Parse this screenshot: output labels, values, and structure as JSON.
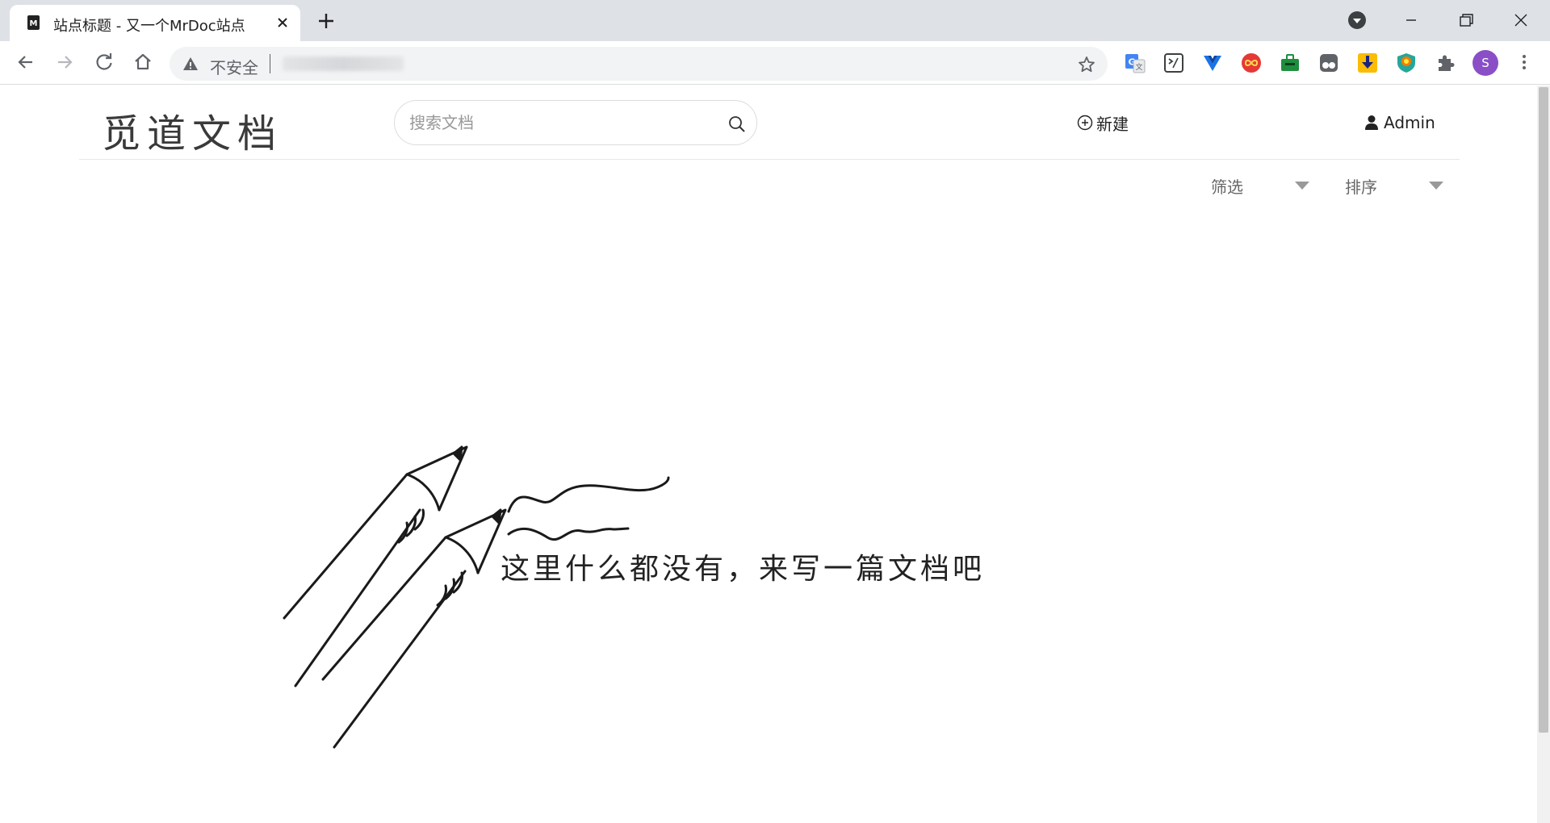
{
  "browser": {
    "tab_title": "站点标题 - 又一个MrDoc站点",
    "new_tab_icon": "plus-icon",
    "address_bar": {
      "security_label": "不安全",
      "security_icon": "warning-triangle-icon"
    },
    "profile_initial": "S",
    "extensions": [
      "google-translate-icon",
      "terminal-icon",
      "vue-devtools-icon",
      "infinity-icon",
      "toolbox-icon",
      "tampermonkey-icon",
      "download-icon",
      "shield-extension-icon",
      "puzzle-icon"
    ]
  },
  "header": {
    "logo_text": "觅道文档",
    "search_placeholder": "搜索文档",
    "new_label": "新建",
    "user_label": "Admin"
  },
  "filters": {
    "filter_label": "筛选",
    "sort_label": "排序"
  },
  "empty_state": {
    "message": "这里什么都没有，来写一篇文档吧"
  },
  "colors": {
    "tabstrip": "#dee1e6",
    "avatar": "#8a4fc7",
    "text_primary": "#222222"
  }
}
